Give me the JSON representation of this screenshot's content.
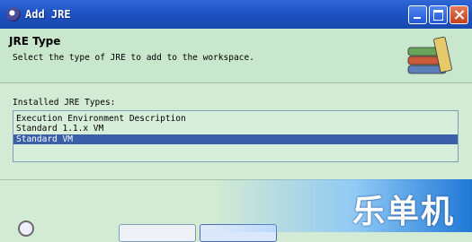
{
  "window": {
    "title": "Add JRE",
    "buttons": {
      "minimize": "minimize",
      "maximize": "maximize",
      "close": "close"
    },
    "title_icon": "eclipse-icon"
  },
  "header": {
    "title": "JRE Type",
    "description": "Select the type of JRE to add to the workspace.",
    "icon": "books-icon"
  },
  "list": {
    "label": "Installed JRE Types:",
    "items": [
      {
        "label": "Execution Environment Description",
        "selected": false
      },
      {
        "label": "Standard 1.1.x VM",
        "selected": false
      },
      {
        "label": "Standard VM",
        "selected": true
      }
    ]
  },
  "footer": {
    "help_icon": "help-icon"
  },
  "watermark": {
    "text": "乐单机"
  },
  "colors": {
    "titlebar": "#1f53c2",
    "selection": "#3b5ea8",
    "background": "#d3ead4"
  }
}
